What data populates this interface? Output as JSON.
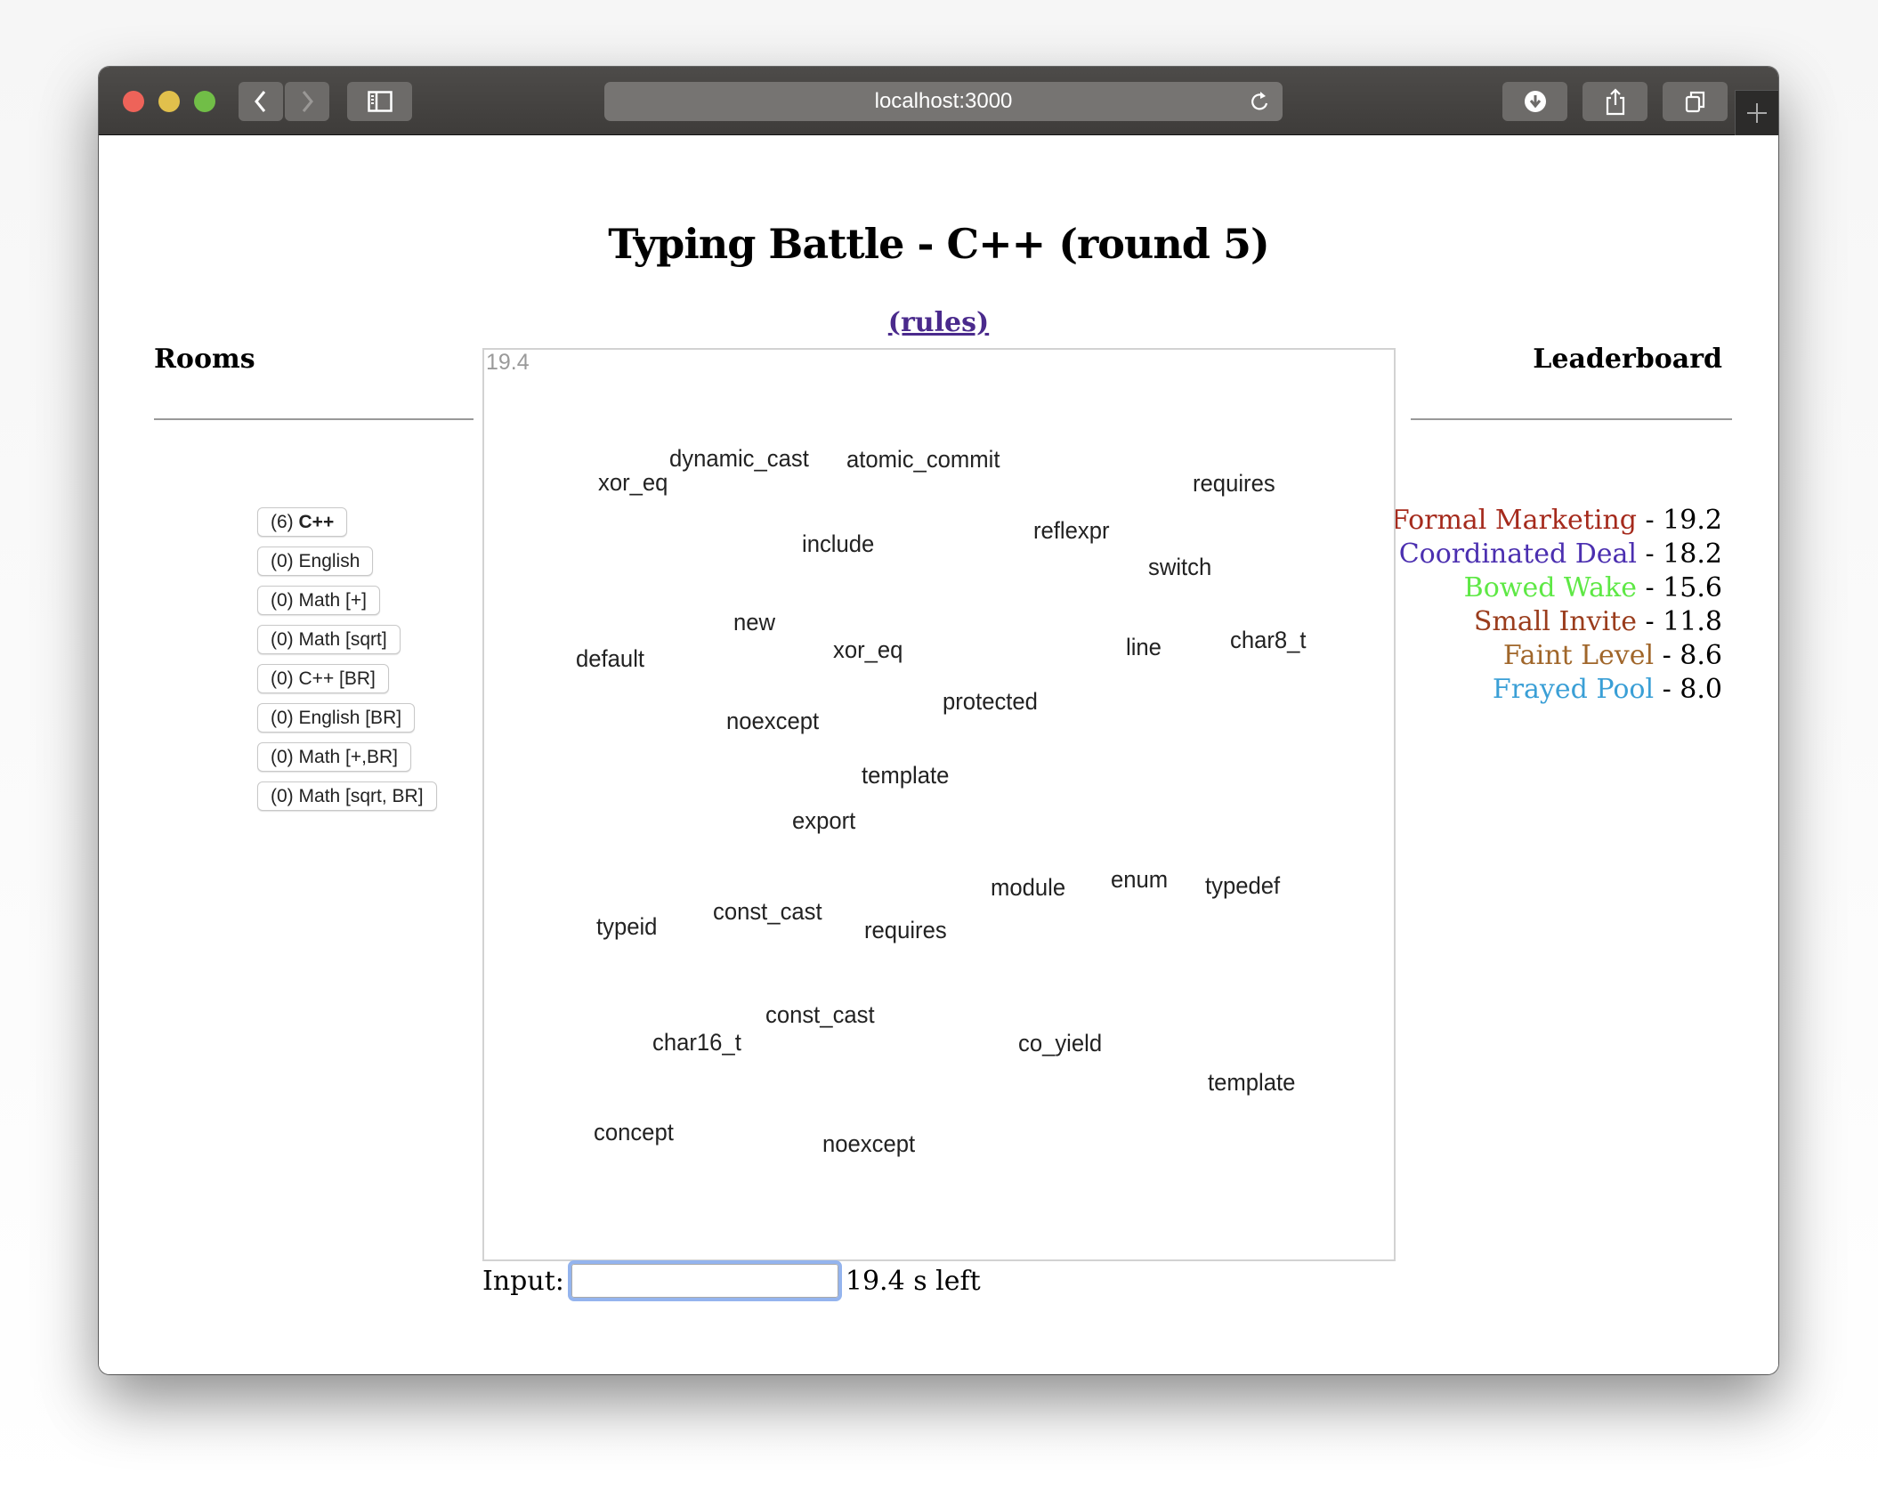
{
  "browser": {
    "url": "localhost:3000",
    "icons": {
      "back": "chevron-left-icon",
      "forward": "chevron-right-icon",
      "sidebar": "sidebar-icon",
      "reload": "reload-icon",
      "download": "download-icon",
      "share": "share-icon",
      "tabs": "tabs-icon",
      "new_tab": "plus-icon"
    }
  },
  "page": {
    "title": "Typing Battle - C++ (round 5)",
    "rules_link": "(rules)"
  },
  "rooms": {
    "heading": "Rooms",
    "items": [
      {
        "count": "(6)",
        "name": "C++",
        "active": true
      },
      {
        "count": "(0)",
        "name": "English",
        "active": false
      },
      {
        "count": "(0)",
        "name": "Math [+]",
        "active": false
      },
      {
        "count": "(0)",
        "name": "Math [sqrt]",
        "active": false
      },
      {
        "count": "(0)",
        "name": "C++ [BR]",
        "active": false
      },
      {
        "count": "(0)",
        "name": "English [BR]",
        "active": false
      },
      {
        "count": "(0)",
        "name": "Math [+,BR]",
        "active": false
      },
      {
        "count": "(0)",
        "name": "Math [sqrt, BR]",
        "active": false
      }
    ]
  },
  "leaderboard": {
    "heading": "Leaderboard",
    "entries": [
      {
        "name": "Formal Marketing",
        "score": "19.2",
        "color": "#a52a1c"
      },
      {
        "name": "Coordinated Deal",
        "score": "18.2",
        "color": "#4b2fb0"
      },
      {
        "name": "Bowed Wake",
        "score": "15.6",
        "color": "#5ee845"
      },
      {
        "name": "Small Invite",
        "score": "11.8",
        "color": "#9a3c1c"
      },
      {
        "name": "Faint Level",
        "score": "8.6",
        "color": "#a0662a"
      },
      {
        "name": "Frayed Pool",
        "score": "8.0",
        "color": "#3a9fd6"
      }
    ],
    "separator": " - "
  },
  "game": {
    "timer": "19.4",
    "words": [
      "xor_eq",
      "dynamic_cast",
      "atomic_commit",
      "requires",
      "include",
      "reflexpr",
      "switch",
      "new",
      "default",
      "xor_eq",
      "line",
      "char8_t",
      "protected",
      "noexcept",
      "template",
      "export",
      "module",
      "enum",
      "typedef",
      "typeid",
      "const_cast",
      "requires",
      "const_cast",
      "char16_t",
      "co_yield",
      "template",
      "concept",
      "noexcept"
    ]
  },
  "input": {
    "label": "Input:",
    "value": "",
    "time_left": "19.4 s left"
  }
}
